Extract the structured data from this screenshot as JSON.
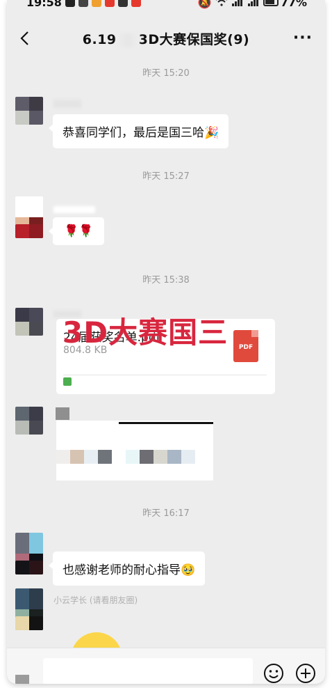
{
  "status_bar": {
    "time": "19:58",
    "battery": "77%"
  },
  "header": {
    "title_left": "6.19",
    "title_right": "3D大赛保国奖(9)",
    "more": "···"
  },
  "timestamps": [
    "昨天 15:20",
    "昨天 15:27",
    "昨天 15:38",
    "昨天 16:17"
  ],
  "messages": {
    "m1": {
      "text": "恭喜同学们，最后是国三哈",
      "emoji": "🎉"
    },
    "m2": {
      "emoji": "🌹🌹"
    },
    "m3": {
      "file_name": "24届获奖名单.pdf",
      "file_size": "804.8 KB",
      "pdf_label": "PDF",
      "overlay": "3D大赛国三"
    },
    "m5": {
      "text": "也感谢老师的耐心指导",
      "emoji": "🥹"
    },
    "m6": {
      "sender": "小云学长 (请看朋友圈)"
    }
  },
  "colors": {
    "chat_bg": "#ededed",
    "bubble_bg": "#ffffff",
    "overlay_red": "#d8263e",
    "pdf_red": "#e04a3c",
    "timestamp_gray": "#9a9a9a"
  }
}
